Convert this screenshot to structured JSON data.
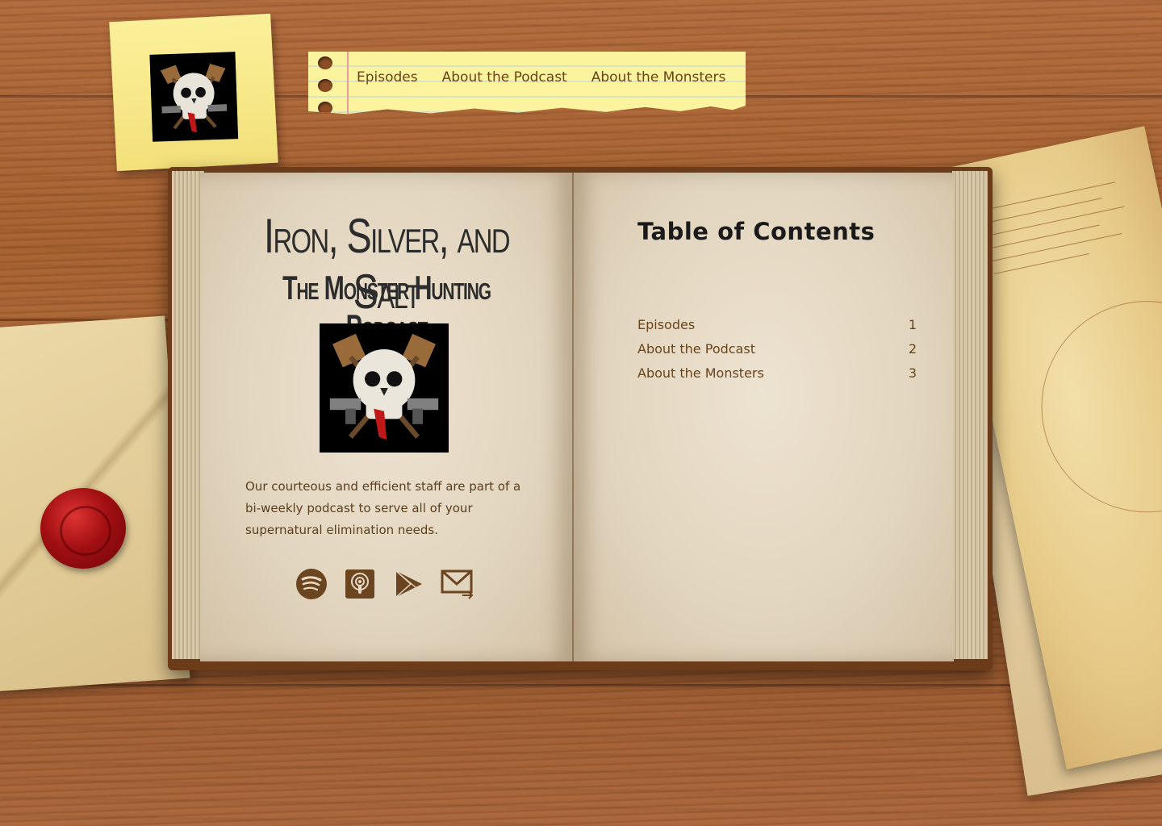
{
  "nav": {
    "items": [
      {
        "label": "Episodes"
      },
      {
        "label": "About the Podcast"
      },
      {
        "label": "About the Monsters"
      }
    ]
  },
  "book": {
    "title": "Iron, Silver, and Salt",
    "subtitle": "The Monster Hunting Podcast",
    "blurb": "Our courteous and efficient staff are part of a bi-weekly podcast to serve all of your supernatural elimination needs.",
    "social": [
      {
        "icon": "spotify-icon"
      },
      {
        "icon": "apple-podcasts-icon"
      },
      {
        "icon": "google-play-icon"
      },
      {
        "icon": "email-icon"
      }
    ]
  },
  "toc": {
    "title": "Table of Contents",
    "entries": [
      {
        "label": "Episodes",
        "page": "1"
      },
      {
        "label": "About the Podcast",
        "page": "2"
      },
      {
        "label": "About the Monsters",
        "page": "3"
      }
    ]
  },
  "colors": {
    "accent": "#6a4418",
    "icon": "#6b4420",
    "wood": "#a9653a",
    "paper": "#e6dac5"
  }
}
